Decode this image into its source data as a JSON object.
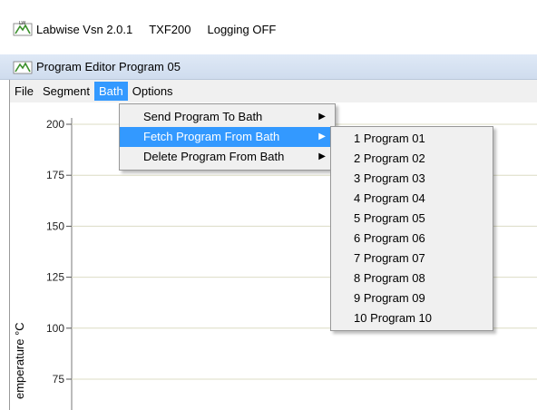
{
  "app_title": {
    "name": "Labwise Vsn 2.0.1",
    "device": "TXF200",
    "logging": "Logging OFF"
  },
  "editor_title": "Program Editor  Program 05",
  "menubar": {
    "items": [
      "File",
      "Segment",
      "Bath",
      "Options"
    ],
    "active": "Bath"
  },
  "bath_menu": {
    "items": [
      "Send Program To Bath",
      "Fetch Program From Bath",
      "Delete Program From Bath"
    ],
    "active": "Fetch Program From Bath",
    "arrow": "▶"
  },
  "fetch_submenu": {
    "items": [
      "1  Program 01",
      "2  Program 02",
      "3  Program 03",
      "4  Program 04",
      "5  Program 05",
      "6  Program 06",
      "7  Program 07",
      "8  Program 08",
      "9  Program 09",
      "10  Program 10"
    ]
  },
  "chart_data": {
    "type": "line",
    "ylabel": "emperature °C",
    "y_ticks": [
      200,
      175,
      150,
      125,
      100,
      75
    ],
    "grid": "horizontal",
    "series": []
  },
  "colors": {
    "highlight": "#3399ff",
    "menu_bg": "#f0f0f0",
    "gridline": "#dcdcc4",
    "icon_green": "#3a8f2a"
  },
  "icons": [
    "labwise-logo-icon",
    "submenu-arrow-icon"
  ]
}
